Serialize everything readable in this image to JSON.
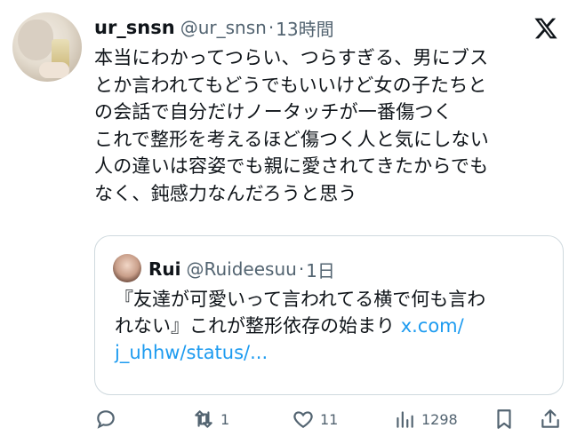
{
  "tweet": {
    "author": {
      "name": "ur_snsn",
      "handle": "@ur_snsn",
      "separator": "·",
      "time": "13時間"
    },
    "text_lines": [
      "本当にわかってつらい、つらすぎる、男にブス",
      "とか言われてもどうでもいいけど女の子たちと",
      "の会話で自分だけノータッチが一番傷つく",
      "これで整形を考えるほど傷つく人と気にしない",
      "人の違いは容姿でも親に愛されてきたからでも",
      "なく、鈍感力なんだろうと思う"
    ],
    "quoted": {
      "name": "Rui",
      "handle": "@Ruideesuu",
      "separator": "·",
      "time": "1日",
      "line1": "『友達が可愛いって言われてる横で何も言わ",
      "line2_text": "れない』これが整形依存の始まり ",
      "line2_link": "x.com/",
      "line3_link": "j_uhhw/status/..."
    },
    "actions": {
      "reply_icon": "reply-icon",
      "retweet_count": "1",
      "like_count": "11",
      "views_count": "1298",
      "bookmark_icon": "bookmark-icon",
      "share_icon": "share-icon"
    },
    "colors": {
      "text": "#0f1419",
      "secondary": "#536471",
      "link": "#1d9bf0",
      "border": "#cfd9de"
    }
  }
}
